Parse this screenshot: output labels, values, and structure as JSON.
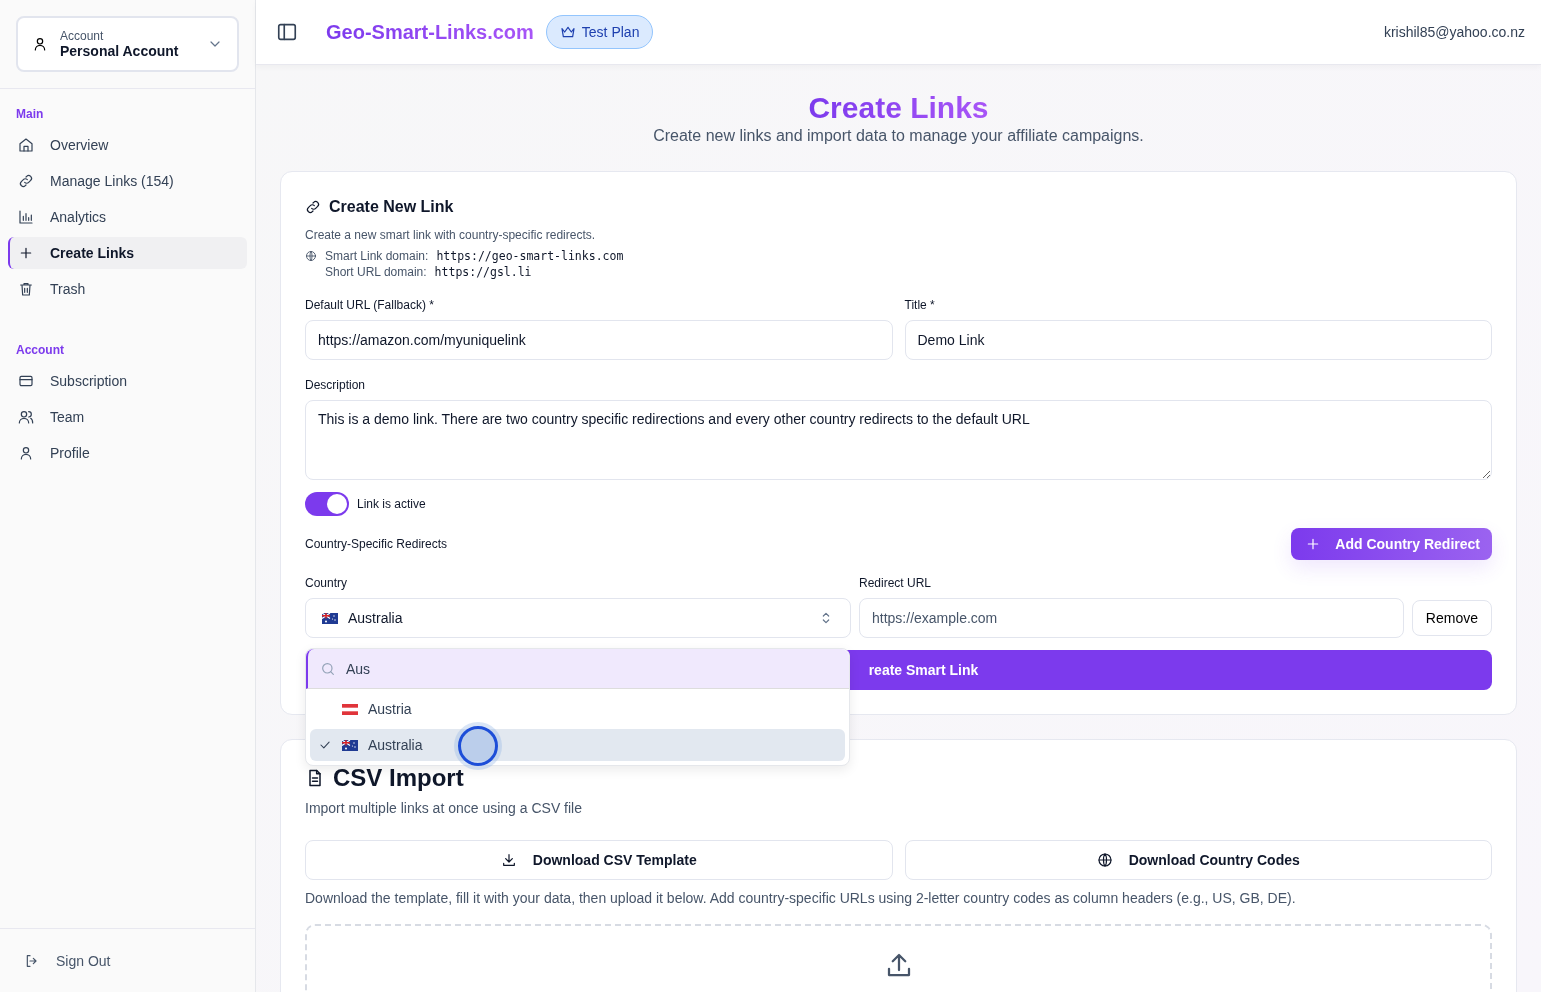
{
  "account": {
    "label": "Account",
    "name": "Personal Account"
  },
  "sidebar": {
    "sections": [
      {
        "title": "Main",
        "items": [
          {
            "label": "Overview",
            "selected": false
          },
          {
            "label": "Manage Links (154)",
            "selected": false
          },
          {
            "label": "Analytics",
            "selected": false
          },
          {
            "label": "Create Links",
            "selected": true
          },
          {
            "label": "Trash",
            "selected": false
          }
        ]
      },
      {
        "title": "Account",
        "items": [
          {
            "label": "Subscription",
            "selected": false
          },
          {
            "label": "Team",
            "selected": false
          },
          {
            "label": "Profile",
            "selected": false
          }
        ]
      }
    ],
    "sign_out": "Sign Out"
  },
  "header": {
    "brand": "Geo-Smart-Links.com",
    "plan": "Test Plan",
    "email": "krishil85@yahoo.co.nz"
  },
  "page": {
    "title": "Create Links",
    "subtitle": "Create new links and import data to manage your affiliate campaigns."
  },
  "create_card": {
    "title": "Create New Link",
    "description": "Create a new smart link with country-specific redirects.",
    "smart_domain_label": "Smart Link domain:",
    "smart_domain": "https://geo-smart-links.com",
    "short_domain_label": "Short URL domain:",
    "short_domain": "https://gsl.li",
    "default_url": {
      "label": "Default URL (Fallback) *",
      "value": "https://amazon.com/myuniquelink"
    },
    "title_field": {
      "label": "Title *",
      "value": "Demo Link"
    },
    "description_field": {
      "label": "Description",
      "value": "This is a demo link. There are two country specific redirections and every other country redirects to the default URL"
    },
    "active_toggle": {
      "label": "Link is active",
      "on": true
    },
    "redirects_label": "Country-Specific Redirects",
    "add_redirect": "Add Country Redirect",
    "country_label": "Country",
    "redirect_url_label": "Redirect URL",
    "country": {
      "value": "Australia",
      "kind": "au"
    },
    "redirect_url": {
      "placeholder": "https://example.com"
    },
    "remove": "Remove",
    "submit": "reate Smart Link",
    "dropdown": {
      "search": "Aus",
      "options": [
        {
          "label": "Austria",
          "kind": "at",
          "selected": false
        },
        {
          "label": "Australia",
          "kind": "au",
          "selected": true
        }
      ]
    }
  },
  "csv_card": {
    "title": "CSV Import",
    "subtitle": "Import multiple links at once using a CSV file",
    "download_template": "Download CSV Template",
    "download_codes": "Download Country Codes",
    "help": "Download the template, fill it with your data, then upload it below. Add country-specific URLs using 2-letter country codes as column headers (e.g., US, GB, DE)."
  }
}
